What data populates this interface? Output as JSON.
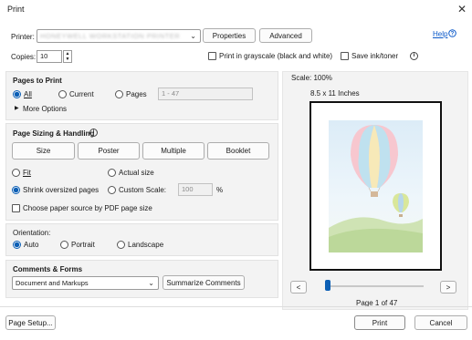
{
  "window": {
    "title": "Print"
  },
  "printer": {
    "label": "Printer:",
    "value": "HONEYWELL WORKSTATION PRINTER",
    "properties_label": "Properties",
    "advanced_label": "Advanced",
    "help_label": "Help"
  },
  "copies": {
    "label": "Copies:",
    "value": "10"
  },
  "options": {
    "grayscale_label": "Print in grayscale (black and white)",
    "save_ink_label": "Save ink/toner"
  },
  "pages_to_print": {
    "title": "Pages to Print",
    "all_label": "All",
    "current_label": "Current",
    "pages_label": "Pages",
    "pages_range": "1 - 47",
    "more_options_label": "More Options"
  },
  "sizing": {
    "title": "Page Sizing & Handling",
    "tabs": [
      "Size",
      "Poster",
      "Multiple",
      "Booklet"
    ],
    "fit_label": "Fit",
    "actual_size_label": "Actual size",
    "shrink_label": "Shrink oversized pages",
    "custom_scale_label": "Custom Scale:",
    "custom_scale_value": "100",
    "percent_label": "%",
    "paper_source_label": "Choose paper source by PDF page size"
  },
  "orientation": {
    "title": "Orientation:",
    "auto_label": "Auto",
    "portrait_label": "Portrait",
    "landscape_label": "Landscape"
  },
  "comments": {
    "title": "Comments & Forms",
    "value": "Document and Markups",
    "summarize_label": "Summarize Comments"
  },
  "preview": {
    "scale_label": "Scale: 100%",
    "size_label": "8.5 x 11 Inches",
    "page_label": "Page 1 of 47",
    "prev_label": "<",
    "next_label": ">"
  },
  "footer": {
    "page_setup_label": "Page Setup...",
    "print_label": "Print",
    "cancel_label": "Cancel"
  },
  "colors": {
    "accent": "#0c5fb5",
    "panel": "#f3f3f3"
  }
}
